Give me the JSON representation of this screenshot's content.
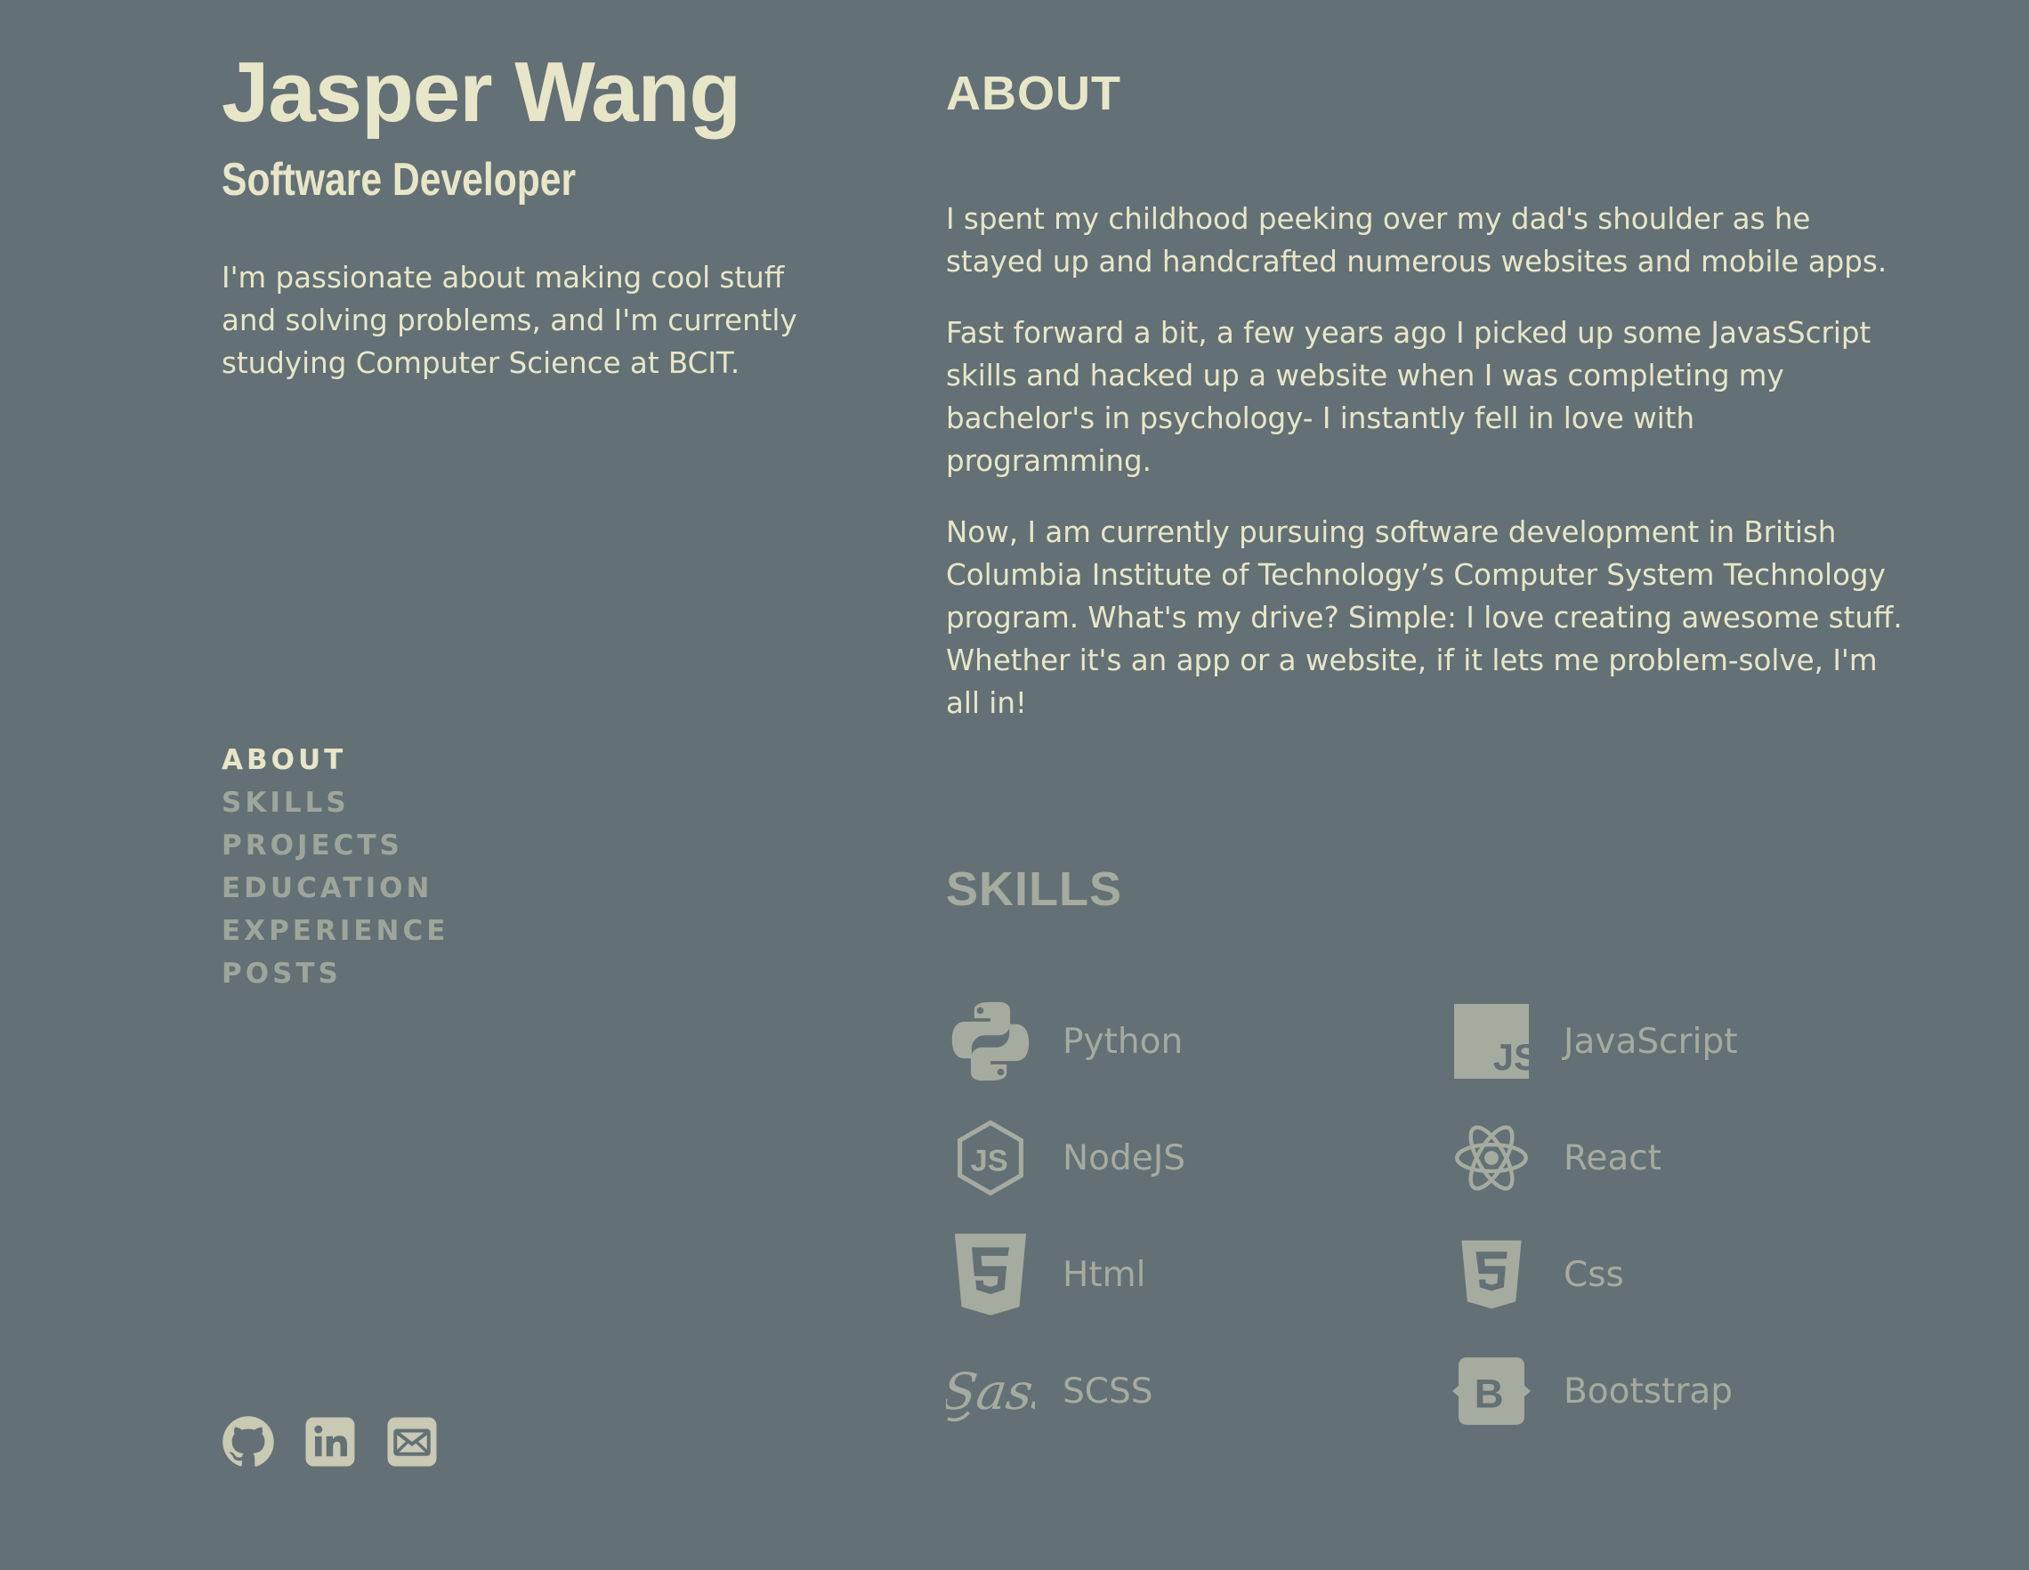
{
  "profile": {
    "name": "Jasper Wang",
    "role": "Software Developer",
    "intro": "I'm passionate about making cool stuff and solving problems, and I'm currently studying Computer Science at BCIT."
  },
  "nav": {
    "items": [
      "ABOUT",
      "SKILLS",
      "PROJECTS",
      "EDUCATION",
      "EXPERIENCE",
      "POSTS"
    ],
    "active": "ABOUT"
  },
  "social": [
    {
      "icon": "github-icon"
    },
    {
      "icon": "linkedin-icon"
    },
    {
      "icon": "email-icon"
    }
  ],
  "about": {
    "title": "ABOUT",
    "paragraphs": [
      "I spent my childhood peeking over my dad's shoulder as he stayed up and handcrafted numerous websites and mobile apps.",
      "Fast forward a bit, a few years ago I picked up some JavasScript skills and hacked up a website when I was completing my bachelor's in psychology- I instantly fell in love with programming.",
      "Now, I am currently pursuing software development in British Columbia Institute of Technology’s Computer System Technology program. What's my drive? Simple: I love creating awesome stuff. Whether it's an app or a website, if it lets me problem-solve, I'm all in!"
    ]
  },
  "skills": {
    "title": "SKILLS",
    "items": [
      {
        "label": "Python",
        "icon": "python-icon"
      },
      {
        "label": "JavaScript",
        "icon": "javascript-icon"
      },
      {
        "label": "NodeJS",
        "icon": "nodejs-icon"
      },
      {
        "label": "React",
        "icon": "react-icon"
      },
      {
        "label": "Html",
        "icon": "html5-icon"
      },
      {
        "label": "Css",
        "icon": "css3-icon"
      },
      {
        "label": "SCSS",
        "icon": "sass-icon"
      },
      {
        "label": "Bootstrap",
        "icon": "bootstrap-icon"
      }
    ]
  },
  "colors": {
    "background": "#637075",
    "text": "#e8e6c8",
    "muted": "#a6ab9f",
    "nav_muted": "#9ea59a"
  }
}
